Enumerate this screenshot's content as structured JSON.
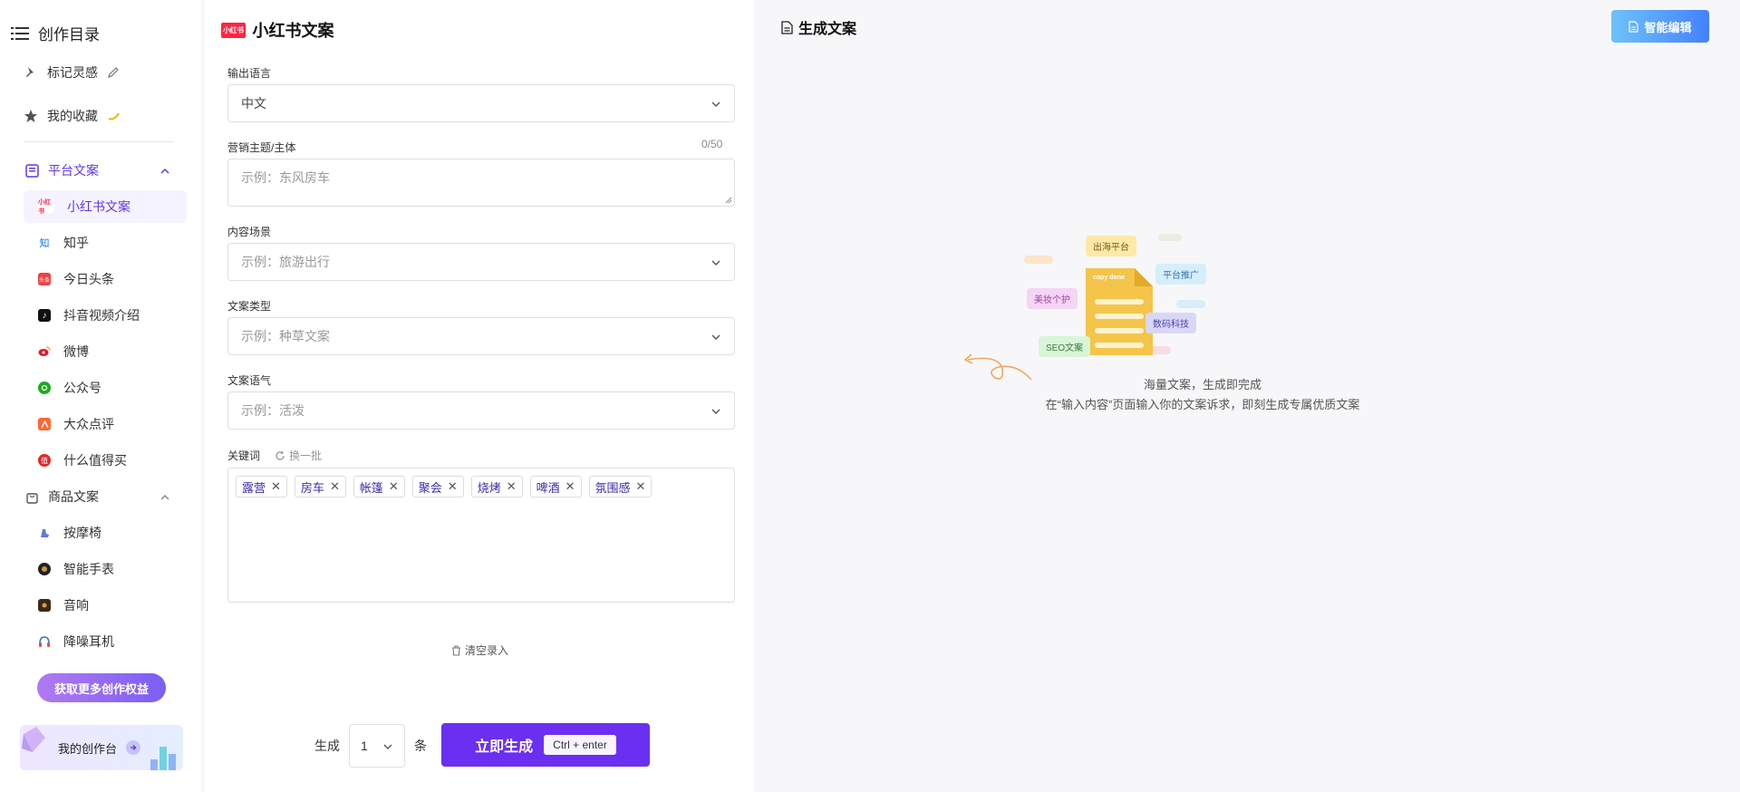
{
  "sidebar": {
    "title": "创作目录",
    "inspiration": "标记灵感",
    "favorites": "我的收藏",
    "platform_group": "平台文案",
    "platform_items": [
      {
        "label": "小红书文案",
        "icon": "xiaohongshu-icon",
        "badge": "小红书"
      },
      {
        "label": "知乎",
        "icon": "zhihu-icon",
        "badge": "知"
      },
      {
        "label": "今日头条",
        "icon": "toutiao-icon",
        "badge": "头条"
      },
      {
        "label": "抖音视频介绍",
        "icon": "douyin-icon",
        "badge": "♪"
      },
      {
        "label": "微博",
        "icon": "weibo-icon",
        "badge": ""
      },
      {
        "label": "公众号",
        "icon": "wechat-icon",
        "badge": ""
      },
      {
        "label": "大众点评",
        "icon": "dianping-icon",
        "badge": ""
      },
      {
        "label": "什么值得买",
        "icon": "smzdm-icon",
        "badge": "值"
      }
    ],
    "product_group": "商品文案",
    "product_items": [
      {
        "label": "按摩椅",
        "icon": "massage-chair-icon"
      },
      {
        "label": "智能手表",
        "icon": "smartwatch-icon"
      },
      {
        "label": "音响",
        "icon": "speaker-icon"
      },
      {
        "label": "降噪耳机",
        "icon": "headphones-icon"
      }
    ],
    "rights_button": "获取更多创作权益",
    "studio_card": "我的创作台"
  },
  "form": {
    "title": "小红书文案",
    "logo_text": "小红书",
    "language_label": "输出语言",
    "language_value": "中文",
    "topic_label": "营销主题/主体",
    "topic_counter": "0/50",
    "topic_placeholder": "示例：东风房车",
    "scene_label": "内容场景",
    "scene_placeholder": "示例：旅游出行",
    "type_label": "文案类型",
    "type_placeholder": "示例：种草文案",
    "tone_label": "文案语气",
    "tone_placeholder": "示例：活泼",
    "keywords_label": "关键词",
    "refresh_label": "换一批",
    "keywords": [
      "露营",
      "房车",
      "帐篷",
      "聚会",
      "烧烤",
      "啤酒",
      "氛围感"
    ],
    "clear_label": "清空录入",
    "generate_prefix": "生成",
    "generate_count": "1",
    "generate_suffix": "条",
    "generate_button": "立即生成",
    "shortcut": "Ctrl + enter"
  },
  "result": {
    "title": "生成文案",
    "smart_edit": "智能编辑",
    "empty_title": "海量文案，生成即完成",
    "empty_sub": "在“输入内容”页面输入你的文案诉求，即刻生成专属优质文案",
    "illustration_pills": [
      "出海平台",
      "平台推广",
      "美妆个护",
      "数码科技",
      "SEO文案"
    ],
    "doc_text": "copy done"
  },
  "colors": {
    "accent": "#6a2ff0",
    "brand_red": "#ff2442",
    "smart_blue": "#4481ff"
  }
}
